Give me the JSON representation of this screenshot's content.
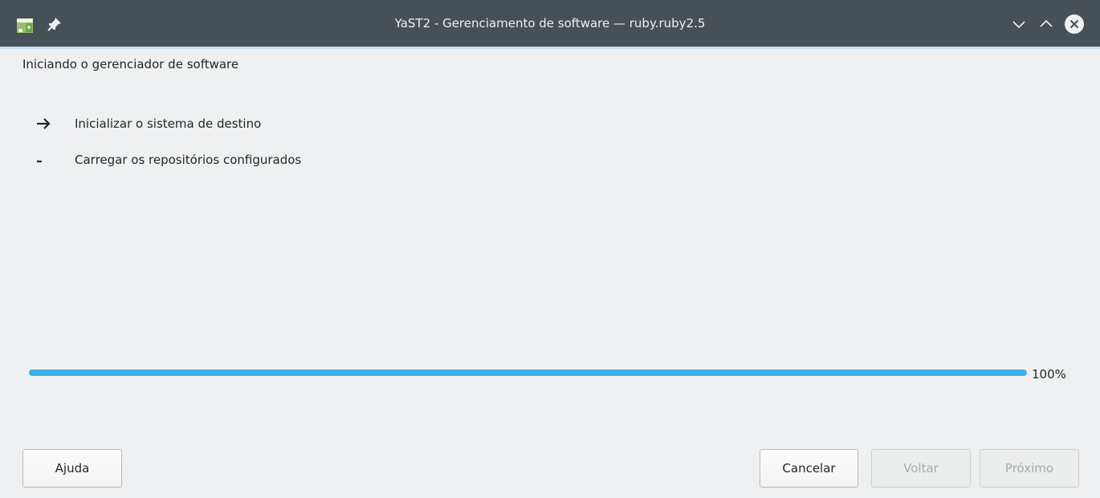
{
  "window": {
    "title": "YaST2 - Gerenciamento de software — ruby.ruby2.5"
  },
  "icons": {
    "app": "yast-package-icon",
    "pin": "pin-icon",
    "minimize": "chevron-down-icon",
    "maximize": "chevron-up-icon",
    "close": "close-circle-icon"
  },
  "heading": "Iniciando o gerenciador de software",
  "steps": [
    {
      "marker": "arrow-right",
      "label": "Inicializar o sistema de destino"
    },
    {
      "marker": "dash",
      "label": "Carregar os repositórios configurados"
    }
  ],
  "progress": {
    "value": 1.0,
    "text": "100%"
  },
  "buttons": {
    "help": "Ajuda",
    "cancel": "Cancelar",
    "back": "Voltar",
    "next": "Próximo"
  },
  "colors": {
    "titlebar": "#475057",
    "accent": "#3daee9",
    "background": "#eff0f1"
  }
}
